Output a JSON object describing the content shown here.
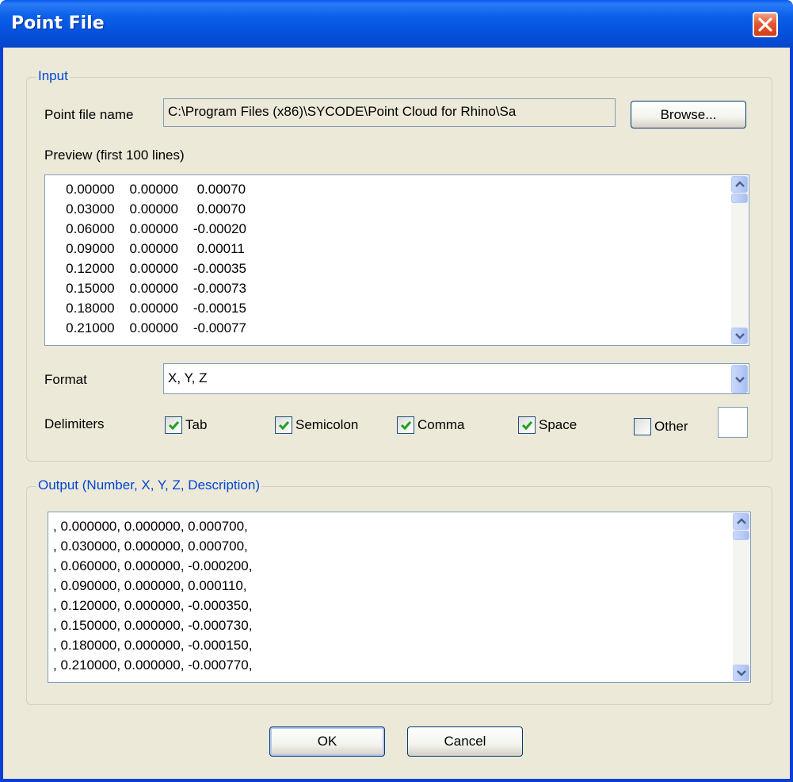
{
  "window": {
    "title": "Point File"
  },
  "input_group": {
    "legend": "Input",
    "file_name_label": "Point file name",
    "file_name_value": "C:\\Program Files (x86)\\SYCODE\\Point Cloud for Rhino\\Sa",
    "browse_label": "Browse...",
    "preview_label": "Preview (first 100 lines)",
    "preview_lines": [
      "   0.00000    0.00000     0.00070",
      "   0.03000    0.00000     0.00070",
      "   0.06000    0.00000    -0.00020",
      "   0.09000    0.00000     0.00011",
      "   0.12000    0.00000    -0.00035",
      "   0.15000    0.00000    -0.00073",
      "   0.18000    0.00000    -0.00015",
      "   0.21000    0.00000    -0.00077"
    ],
    "format_label": "Format",
    "format_value": "X, Y, Z",
    "delimiters_label": "Delimiters",
    "delimiters": [
      {
        "label": "Tab",
        "checked": true
      },
      {
        "label": "Semicolon",
        "checked": true
      },
      {
        "label": "Comma",
        "checked": true
      },
      {
        "label": "Space",
        "checked": true
      },
      {
        "label": "Other",
        "checked": false
      }
    ]
  },
  "output_group": {
    "legend": "Output (Number, X, Y, Z, Description)",
    "lines": [
      ", 0.000000, 0.000000, 0.000700,",
      ", 0.030000, 0.000000, 0.000700,",
      ", 0.060000, 0.000000, -0.000200,",
      ", 0.090000, 0.000000, 0.000110,",
      ", 0.120000, 0.000000, -0.000350,",
      ", 0.150000, 0.000000, -0.000730,",
      ", 0.180000, 0.000000, -0.000150,",
      ", 0.210000, 0.000000, -0.000770,"
    ]
  },
  "footer": {
    "ok_label": "OK",
    "cancel_label": "Cancel"
  },
  "colors": {
    "title_bar": "#0451dc",
    "group_legend": "#0046d5",
    "dialog_bg": "#ece9d8",
    "check_mark": "#21a121"
  }
}
